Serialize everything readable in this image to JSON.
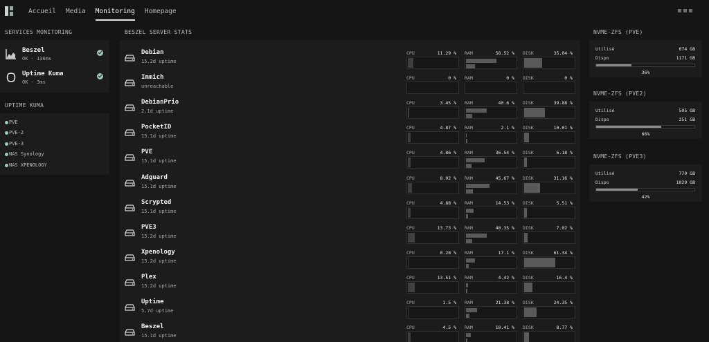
{
  "nav": {
    "items": [
      "Accueil",
      "Media",
      "Monitoring",
      "Homepage"
    ],
    "active": "Monitoring"
  },
  "left": {
    "services_title": "SERVICES MONITORING",
    "services": [
      {
        "name": "Beszel",
        "status": "OK - 136ms",
        "icon": "chart-line-icon"
      },
      {
        "name": "Uptime Kuma",
        "status": "OK - 3ms",
        "icon": "uptime-kuma-icon"
      }
    ],
    "uptime_title": "UPTIME KUMA",
    "uptime_items": [
      "PVE",
      "PVE-2",
      "PVE-3",
      "NAS Synology",
      "NAS XPENOLOGY"
    ]
  },
  "beszel": {
    "title": "BESZEL SERVER STATS",
    "labels": {
      "cpu": "CPU",
      "ram": "RAM",
      "disk": "DISK"
    },
    "servers": [
      {
        "name": "Debian",
        "uptime": "15.2d uptime",
        "cpu": "11.29 %",
        "ram": "58.52 %",
        "disk": "35.04 %",
        "cpu_f": 0.11,
        "ram_f": 0.59,
        "disk_f": 0.35
      },
      {
        "name": "Immich",
        "uptime": "unreachable",
        "cpu": "0 %",
        "ram": "0 %",
        "disk": "0 %",
        "cpu_f": 0,
        "ram_f": 0,
        "disk_f": 0
      },
      {
        "name": "DebianPrio",
        "uptime": "2.1d uptime",
        "cpu": "3.45 %",
        "ram": "40.6 %",
        "disk": "39.88 %",
        "cpu_f": 0.03,
        "ram_f": 0.41,
        "disk_f": 0.4
      },
      {
        "name": "PocketID",
        "uptime": "15.1d uptime",
        "cpu": "4.87 %",
        "ram": "2.1 %",
        "disk": "10.01 %",
        "cpu_f": 0.05,
        "ram_f": 0.02,
        "disk_f": 0.1
      },
      {
        "name": "PVE",
        "uptime": "15.1d uptime",
        "cpu": "4.86 %",
        "ram": "36.54 %",
        "disk": "6.18 %",
        "cpu_f": 0.05,
        "ram_f": 0.37,
        "disk_f": 0.06
      },
      {
        "name": "Adguard",
        "uptime": "15.1d uptime",
        "cpu": "8.02 %",
        "ram": "45.67 %",
        "disk": "31.16 %",
        "cpu_f": 0.08,
        "ram_f": 0.46,
        "disk_f": 0.31
      },
      {
        "name": "Scrypted",
        "uptime": "15.1d uptime",
        "cpu": "4.88 %",
        "ram": "14.53 %",
        "disk": "5.51 %",
        "cpu_f": 0.05,
        "ram_f": 0.15,
        "disk_f": 0.06
      },
      {
        "name": "PVE3",
        "uptime": "15.2d uptime",
        "cpu": "13.73 %",
        "ram": "40.35 %",
        "disk": "7.02 %",
        "cpu_f": 0.14,
        "ram_f": 0.4,
        "disk_f": 0.07
      },
      {
        "name": "Xpenology",
        "uptime": "15.2d uptime",
        "cpu": "0.28 %",
        "ram": "17.1 %",
        "disk": "61.34 %",
        "cpu_f": 0.01,
        "ram_f": 0.17,
        "disk_f": 0.61
      },
      {
        "name": "Plex",
        "uptime": "15.2d uptime",
        "cpu": "13.51 %",
        "ram": "4.42 %",
        "disk": "16.4 %",
        "cpu_f": 0.14,
        "ram_f": 0.04,
        "disk_f": 0.16
      },
      {
        "name": "Uptime",
        "uptime": "5.7d uptime",
        "cpu": "1.5 %",
        "ram": "21.38 %",
        "disk": "24.35 %",
        "cpu_f": 0.02,
        "ram_f": 0.21,
        "disk_f": 0.24
      },
      {
        "name": "Beszel",
        "uptime": "15.1d uptime",
        "cpu": "4.5 %",
        "ram": "10.41 %",
        "disk": "8.77 %",
        "cpu_f": 0.05,
        "ram_f": 0.1,
        "disk_f": 0.09
      }
    ]
  },
  "zfs": [
    {
      "title": "NVME-ZFS (PVE)",
      "used_label": "Utilisé",
      "used": "674 GB",
      "free_label": "Dispo",
      "free": "1171 GB",
      "pct": "36%",
      "pct_f": 0.36
    },
    {
      "title": "NVME-ZFS (PVE2)",
      "used_label": "Utilisé",
      "used": "505 GB",
      "free_label": "Dispo",
      "free": "251 GB",
      "pct": "66%",
      "pct_f": 0.66
    },
    {
      "title": "NVME-ZFS (PVE3)",
      "used_label": "Utilisé",
      "used": "770 GB",
      "free_label": "Dispo",
      "free": "1029 GB",
      "pct": "42%",
      "pct_f": 0.42
    }
  ],
  "colors": {
    "background": "#151515",
    "panel": "#1c1c1c",
    "ok": "#9fc7b3",
    "bar": "#5a5a5a"
  }
}
